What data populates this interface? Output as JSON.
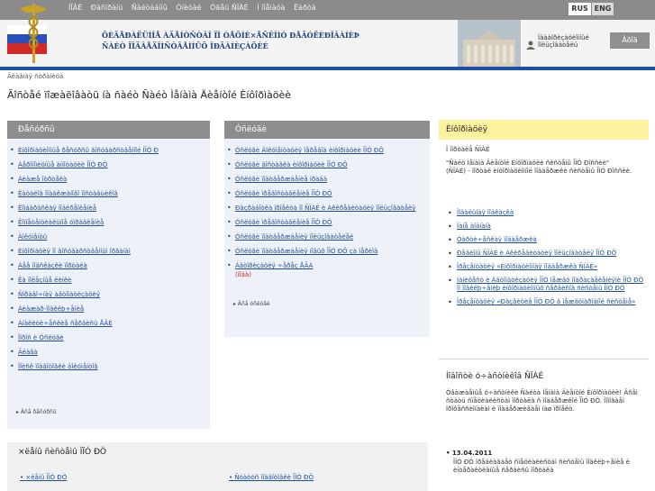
{
  "top_nav": {
    "links": [
      "ÍÏÀÉ",
      "Ðàñïðàíü",
      "Ñàéòàáííû",
      "Óíèòàé",
      "Óãåü ÑÏÀÉ",
      "Ì íîåìàóà",
      "Ëàðòà"
    ],
    "lang": {
      "rus": "RUS",
      "eng": "ENG"
    }
  },
  "header": {
    "title_line1": "ÔÈÄÅÐÀËÜÍÎÅ ÀÃÅÍÒÑÒÂÎ ÏÎ ÒÅÕÍÈ×ÅÑÊÎÌÓ ÐÅÃÓËÈÐÎÂÀÍÈÞ",
    "title_line2": "ÑÀÉÒ ÏÎÄÂÅÄÎÌÑÒÂÅÍÍÛÕ ÎÐÃÀÍÈÇÀÖÈÉ",
    "user_text": "Íäààîðèçàöèîííûé îîëüçîâàòåëü",
    "exit_label": "Âõîä"
  },
  "breadcrumb": "Ãëàâíàÿ ñòðàíèöà",
  "page_title": "Ãîñòåé ïîæàëîâàòü íà ñàéò Ñàéò Ìåíàìà Äèåíòîé Èíôîðìàöèè",
  "panel_left": {
    "title": "Ðåñóðñû",
    "items": [
      "Èíôîðìàöèîííûå ðåñóðñû ãîñóäàðñòâåííîé ÎÏÓ Ð",
      "Àåðîíîìèöíûå àííîòàöèè ÎÏÓ ÐÖ",
      "Àèäæå îòðòåëà",
      "Ëàòàëîã îîàäêæàíîãî ïîñòàâùèêîâ",
      "Ëîìáàðäñêàÿ ïîäêðåïëåíèå",
      "Êîìïåòåíöèàëüíîå óïðàâëåíèå",
      "Äîêóìåíòû",
      "Èíôîðìàöèÿ ïî ãîñóäàðñòâåííûì îðãàíàì",
      "Àåå ïîäñêàçêè ïîðòàëà",
      "Êà ïîëåçíûå ëèíêè",
      "Ñïðàâî÷íàÿ àâòîìàòèçàöèÿ",
      "Àèäæàð-ïîäêëþ÷åíèå",
      "Àíàëèòè÷åñêèå ñåðâèñû ÅÃÈ",
      "Îïðîñ è Óñëóãè",
      "Ãëàâà",
      "Ïîèñê ïîäãîòîâêè äîêóìåíòîâ"
    ],
    "more": "Âñå ðåñóðñû"
  },
  "panel_mid": {
    "title": "Óñëóãè",
    "items": [
      "Óñëóãè Äîêóìåíòàöèÿ ïåðåâîä èíôîðìàöèè ÎÏÓ ÐÖ",
      "Óñëóãè äîñòàâêà èíôîðìàöèè ÎÏÓ ÐÖ",
      "Óñëóãè ïîäòâåðæäåíèå ïðàâà",
      "Óñëóãè ïðåäîñòàâëåíèå ÎÏÓ ÐÖ",
      "Ðàçðàáîòêà ïðîåêòà ïî ÑÏÀÉ è Àêêðåäèòàöèÿ ïîëüçîâàòåëÿ",
      "Óñëóãè ïðåäîñòàâëåíèå ÎÏÓ ÐÖ",
      "Óñëóãè ïîäòâåðæäåíèÿ ïîëüçîâàòåëåé",
      "Óñëóãè ïîäòâåðæäåíèÿ íîâûõ ÎÏÓ ÐÖ çà ïåðèîä",
      "Àâòîðèçàöèÿ ÷åðåç ÅÃÀ"
    ],
    "item_sub": "(ïîäà)",
    "more": "Âñå óñëóãè"
  },
  "info": {
    "title": "Èíôîðìàöèÿ",
    "lines": [
      "Î ïîðòàëå ÑÏÀÉ",
      "\"Ñàéò Ìåíàìà Äèåíòîé Èíôîðìàöèè ñèñòåìû ÎÏÓ Ðîññèè\"",
      "(ÑÏÀÉ) - ïîðòàë èíôîðìàöèîííîé ïîääåðæêè ñèñòåìû ÎÏÓ Ðîññèè."
    ],
    "links": [
      "Ïîäàëüíàÿ ïîäêàçêà",
      "Ïàíå àîäíàíà",
      "Óàðòè÷åñêàÿ ïîääåðæêà",
      "Ðåãèîíû ÑÏÀÉ è Àêêðåäèòàöèÿ ïîëüçîâàòåëÿ ÎÏÓ ÐÖ",
      "Ïðåçåíòàöèÿ «Èíôîðìàöèîííàÿ ïîääåðæêà ÑÏÀÉ»",
      "Ìàíèôåñò è Àâòîìàòèçàöèÿ ÎÏÓ ìåæäó ïîäðàçäåëåíèÿìè ÎÏÓ ÐÖ ïî ïîäêëþ÷åíèþ èíôîðìàöèîííûõ ñåðâèñîâ ñèñòåìû ÎÏÓ ÐÖ",
      "Ïðåçåíòàöèÿ «Ðàçâèòèå ÎÏÓ ÐÖ â ìåæäóíàðîäíîé ñèñòåìå»"
    ]
  },
  "news": {
    "title": "Íîâîñòè ó÷àñòíèêîâ ÑÏÀÉ",
    "body": "Óâàæàåìûå ó÷àñòíèêè Ñàéòà Ìåíàìà Äèåíòîé Èíôîðìàöèè! Âñåì ñòàòü ñïåöèàëèñòàì ïîðòàëà ñ ïîääåðæêîé ÎÏÓ ÐÖ. Ïîìîãàåì ïðîôåññèîíàëàì è ïîääåðæèâàåì íàø ïðîåêò.",
    "date": "13.04.2011",
    "text": "ÎÏÓ ÐÖ ïðåäëàãàåò ñïåöèàëèñòàì ñèñòåìû ïîäêëþ÷åíèå è èíòåðàêòèâíûå ñåðâèñû ïîðòàëà"
  },
  "bottom": {
    "title": "×ëåíû ñèñòåìû ÎÏÓ ÐÖ",
    "link1": "×ëåíû ÎÏÓ ÐÖ",
    "link2": "Ñòàòóñ ïîäãîòîâêè ÎÏÓ ÐÖ"
  },
  "colors": {
    "topbar": "#8b8b8b",
    "accent_blue": "#1d4fa8",
    "panel_head": "#8d8d8d",
    "info_head": "#fbf2a0",
    "link": "#1b4f9c"
  }
}
